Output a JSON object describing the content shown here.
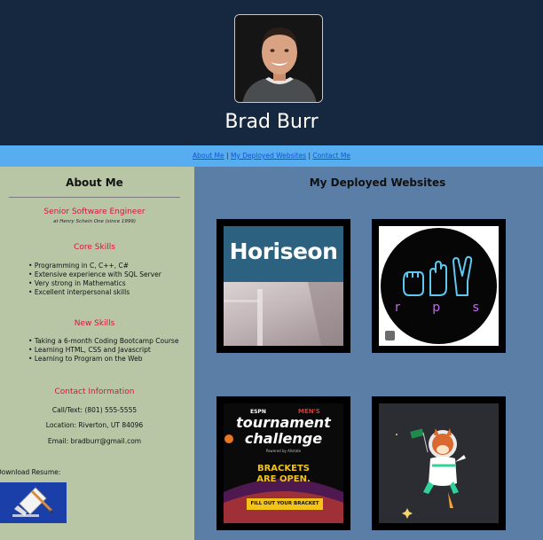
{
  "header": {
    "name": "Brad Burr"
  },
  "nav": {
    "about": "About Me",
    "sep1": " | ",
    "websites": "My Deployed Websites",
    "sep2": " | ",
    "contact": "Contact Me"
  },
  "about": {
    "heading": "About Me",
    "role_title": "Senior Software Engineer",
    "role_sub": "at Henry Schein One (since 1999)",
    "core_skills_title": "Core Skills",
    "core_skills": [
      "Programming in C, C++, C#",
      "Extensive experience with SQL Server",
      "Very strong in Mathematics",
      "Excellent interpersonal skills"
    ],
    "new_skills_title": "New Skills",
    "new_skills": [
      "Taking a 6-month Coding Bootcamp Course",
      "Learning HTML, CSS and Javascript",
      "Learning to Program on the Web"
    ],
    "contact_title": "Contact Information",
    "phone": "Call/Text: (801) 555-5555",
    "location": "Location: Riverton, UT 84096",
    "email": "Email: bradburr@gmail.com",
    "download_label": "Download Resume:"
  },
  "websites": {
    "heading": "My Deployed Websites",
    "horiseon": "Horiseon",
    "rps": "r p s",
    "espn": {
      "brand": "ESPN",
      "mens": "MEN'S",
      "line1": "tournament",
      "line2": "challenge",
      "powered": "Powered by  Allstate",
      "brackets1": "BRACKETS",
      "brackets2": "ARE OPEN.",
      "cta": "FILL OUT YOUR BRACKET"
    }
  }
}
